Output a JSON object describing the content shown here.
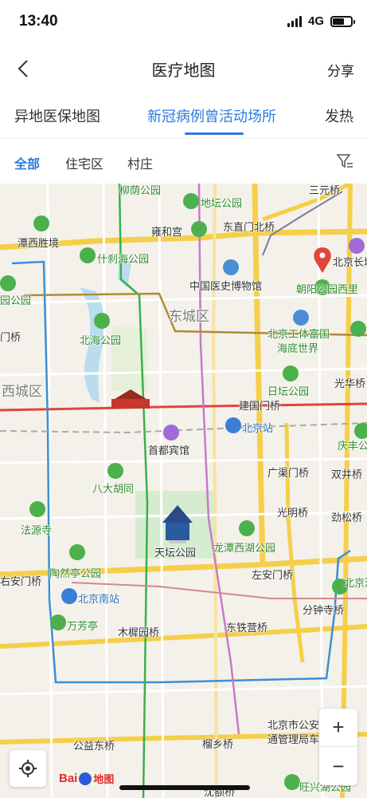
{
  "status": {
    "time": "13:40",
    "network": "4G"
  },
  "nav": {
    "title": "医疗地图",
    "share": "分享"
  },
  "tabs": [
    {
      "label": "异地医保地图"
    },
    {
      "label": "新冠病例曾活动场所"
    },
    {
      "label": "发热"
    }
  ],
  "filters": [
    {
      "label": "全部"
    },
    {
      "label": "住宅区"
    },
    {
      "label": "村庄"
    }
  ],
  "map": {
    "labels": {
      "liuyin": "柳荫公园",
      "ditan": "地坛公园",
      "erhuan": "三元桥",
      "tanxi": "潭西胜境",
      "yonghegong": "雍和宫",
      "dongzhimen": "东直门北桥",
      "shicha": "什刹海公园",
      "zhongyi": "中国医史博物馆",
      "changcheng": "北京长城",
      "chaoyang": "朝阳公园西里",
      "yuan": "园公园",
      "dongcheng": "东城区",
      "beihai": "北海公园",
      "gongti": "北京工体富国",
      "haidi": "海底世界",
      "qiao": "门桥",
      "xicheng": "西城区",
      "ritan": "日坛公园",
      "guanghua": "光华桥",
      "jianguomen": "建国门桥",
      "beijingzhan": "北京站",
      "shoudu": "首都宾馆",
      "qingfeng": "庆丰公",
      "guangqumen": "广渠门桥",
      "shuangjing": "双井桥",
      "badahutong": "八大胡同",
      "guangming": "光明桥",
      "jinsong": "劲松桥",
      "fayuansi": "法源寺",
      "tiantan": "天坛公园",
      "longtan": "龙潭西湖公园",
      "taoranting": "陶然亭公园",
      "youanmen": "右安门桥",
      "zuoanmen": "左安门桥",
      "beijingnan": "北京南站",
      "hewen": "北京河文",
      "fenzhong": "分钟寺桥",
      "wanfangting": "万芳亭",
      "muxiyuan": "木樨园桥",
      "dongtiejiang": "东铁营桥",
      "gongan": "北京市公安",
      "jiaotong": "通管理局车",
      "gongyidong": "公益东桥",
      "liuxiang": "榴乡桥",
      "chenjiao": "沈额桥",
      "wangxing": "旺兴湖公园"
    }
  },
  "colors": {
    "accent": "#2a7ae2",
    "road_major": "#f5cf4a",
    "park": "#4cb04c"
  },
  "footer": {
    "logo": "Bai",
    "logo_suffix": "地图"
  }
}
